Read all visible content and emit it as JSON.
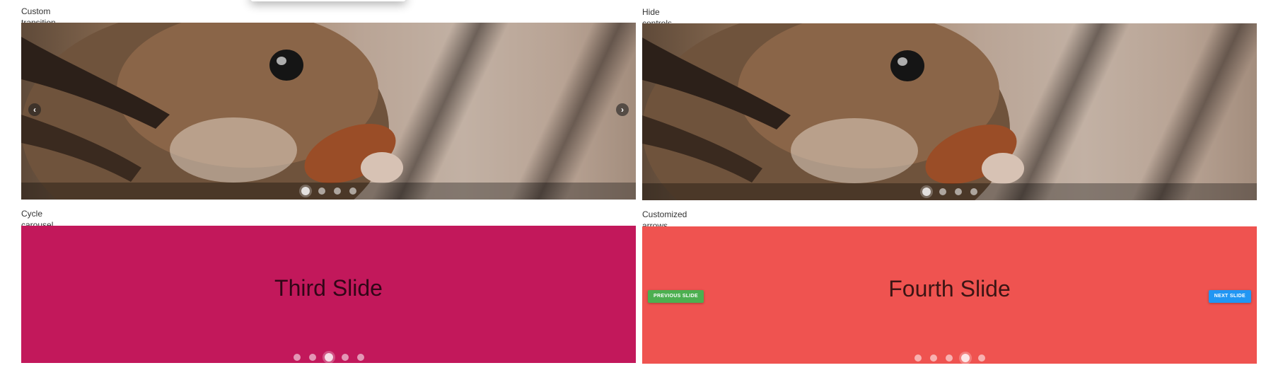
{
  "carousels": [
    {
      "title": "Custom transition carousel",
      "dots": 4,
      "active_index": 0
    },
    {
      "title": "Hide controls carousel",
      "dots": 4,
      "active_index": 0
    },
    {
      "title": "Cycle carousel",
      "slide_label": "Third Slide",
      "slide_color": "#c2185b",
      "dots": 5,
      "active_index": 2
    },
    {
      "title": "Customized arrows carousel",
      "slide_label": "Fourth Slide",
      "slide_color": "#ef5350",
      "dots": 5,
      "active_index": 3,
      "prev_button": "PREVIOUS SLIDE",
      "next_button": "NEXT SLIDE",
      "prev_color": "#4caf50",
      "next_color": "#2196f3"
    }
  ],
  "icons": {
    "prev": "chevron-left-icon",
    "next": "chevron-right-icon"
  }
}
